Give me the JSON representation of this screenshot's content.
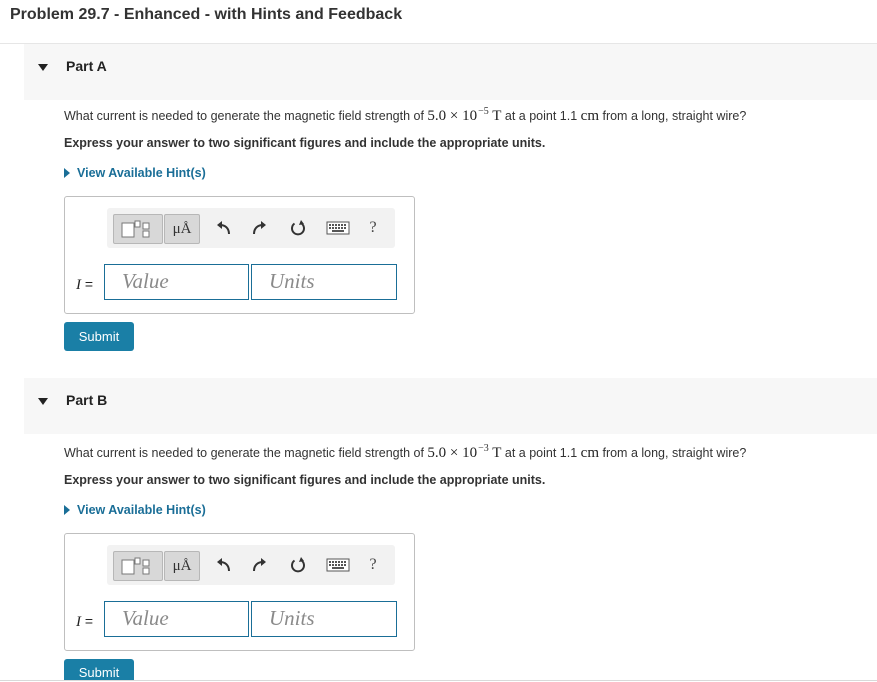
{
  "header": {
    "title": "Problem 29.7 - Enhanced - with Hints and Feedback"
  },
  "parts": [
    {
      "label": "Part A",
      "question": {
        "pre": "What current is needed to generate the magnetic field strength of ",
        "coef": "5.0 × 10",
        "exp": "−5",
        "unit": "T",
        "mid": " at a point 1.1 ",
        "dist_unit": "cm",
        "post": " from a long, straight wire?"
      },
      "instruction": "Express your answer to two significant figures and include the appropriate units.",
      "hint_link": "View Available Hint(s)",
      "toolbar": {
        "units_label": "μÅ",
        "help_label": "?"
      },
      "variable": "I",
      "equals": " =",
      "value_placeholder": "Value",
      "units_placeholder": "Units",
      "submit_label": "Submit"
    },
    {
      "label": "Part B",
      "question": {
        "pre": "What current is needed to generate the magnetic field strength of ",
        "coef": "5.0 × 10",
        "exp": "−3",
        "unit": "T",
        "mid": " at a point 1.1 ",
        "dist_unit": "cm",
        "post": " from a long, straight wire?"
      },
      "instruction": "Express your answer to two significant figures and include the appropriate units.",
      "hint_link": "View Available Hint(s)",
      "toolbar": {
        "units_label": "μÅ",
        "help_label": "?"
      },
      "variable": "I",
      "equals": " =",
      "value_placeholder": "Value",
      "units_placeholder": "Units",
      "submit_label": "Submit"
    }
  ],
  "icons": [
    "caret-down-icon",
    "hint-caret-icon",
    "templates-icon",
    "undo-icon",
    "redo-icon",
    "reset-icon",
    "keyboard-icon",
    "help-icon"
  ],
  "colors": {
    "link": "#1a6e97",
    "submit_bg": "#1a7fa6",
    "header_bg": "#f7f7f7",
    "field_border": "#1a6e97"
  }
}
